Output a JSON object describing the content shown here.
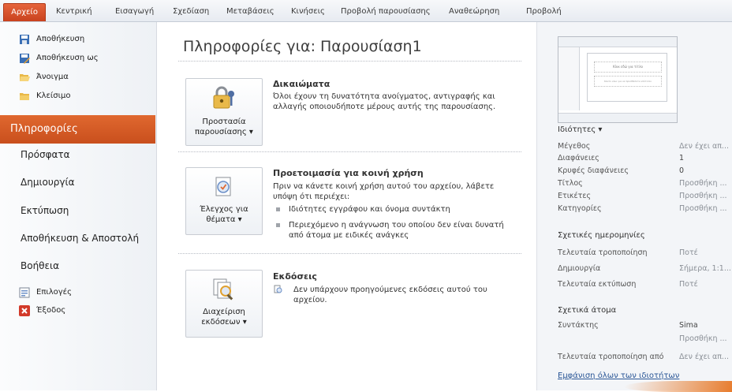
{
  "ribbon": {
    "tabs": [
      "Αρχείο",
      "Κεντρική",
      "Εισαγωγή",
      "Σχεδίαση",
      "Μεταβάσεις",
      "Κινήσεις",
      "Προβολή παρουσίασης",
      "Αναθεώρηση",
      "Προβολή"
    ]
  },
  "left_menu": {
    "commands": [
      "Αποθήκευση",
      "Αποθήκευση ως",
      "Άνοιγμα",
      "Κλείσιμο"
    ],
    "selected": "Πληροφορίες",
    "nav": [
      "Πρόσφατα",
      "Δημιουργία",
      "Εκτύπωση",
      "Αποθήκευση & Αποστολή",
      "Βοήθεια"
    ],
    "bottom": [
      "Επιλογές",
      "Έξοδος"
    ]
  },
  "main": {
    "title": "Πληροφορίες για: Παρουσίαση1",
    "sections": [
      {
        "button": [
          "Προστασία",
          "παρουσίασης ▾"
        ],
        "heading": "Δικαιώματα",
        "text": [
          "Όλοι έχουν τη δυνατότητα ανοίγματος, αντιγραφής και",
          "αλλαγής οποιουδήποτε μέρους αυτής της παρουσίασης."
        ]
      },
      {
        "button": [
          "Έλεγχος για",
          "θέματα ▾"
        ],
        "heading": "Προετοιμασία για κοινή χρήση",
        "text": [
          "Πριν να κάνετε κοινή χρήση αυτού του αρχείου, λάβετε",
          "υπόψη ότι περιέχει:"
        ],
        "bullets": [
          [
            "Ιδιότητες εγγράφου και όνομα συντάκτη"
          ],
          [
            "Περιεχόμενο η ανάγνωση του οποίου δεν είναι δυνατή",
            "από άτομα με ειδικές ανάγκες"
          ]
        ]
      },
      {
        "button": [
          "Διαχείριση",
          "εκδόσεων ▾"
        ],
        "heading": "Εκδόσεις",
        "text": [
          "Δεν υπάρχουν προηγούμενες εκδόσεις αυτού του",
          "αρχείου."
        ]
      }
    ]
  },
  "right_panel": {
    "thumbnail_text": [
      "Κλικ εδώ για τίτλο",
      "Κάντε κλικ για να προσθέσετε υπότιτλο"
    ],
    "properties_header": "Ιδιότητες ▾",
    "properties": [
      {
        "k": "Μέγεθος",
        "v": "Δεν έχει απ..."
      },
      {
        "k": "Διαφάνειες",
        "v": "1"
      },
      {
        "k": "Κρυφές διαφάνειες",
        "v": "0"
      },
      {
        "k": "Τίτλος",
        "v": "Προσθήκη ..."
      },
      {
        "k": "Ετικέτες",
        "v": "Προσθήκη ..."
      },
      {
        "k": "Κατηγορίες",
        "v": "Προσθήκη ..."
      }
    ],
    "dates_header": "Σχετικές ημερομηνίες",
    "dates": [
      {
        "k": "Τελευταία τροποποίηση",
        "v": "Ποτέ"
      },
      {
        "k": "Δημιουργία",
        "v": "Σήμερα, 1:1..."
      },
      {
        "k": "Τελευταία εκτύπωση",
        "v": "Ποτέ"
      }
    ],
    "people_header": "Σχετικά άτομα",
    "author_label": "Συντάκτης",
    "author_name": "Sima",
    "author_add": "Προσθήκη ...",
    "last_modified_by_label": "Τελευταία τροποποίηση από",
    "last_modified_by_value": "Δεν έχει απ...",
    "show_all": "Εμφάνιση όλων των ιδιοτήτων"
  },
  "colors": {
    "accent": "#d35a25",
    "link": "#2b5797"
  }
}
